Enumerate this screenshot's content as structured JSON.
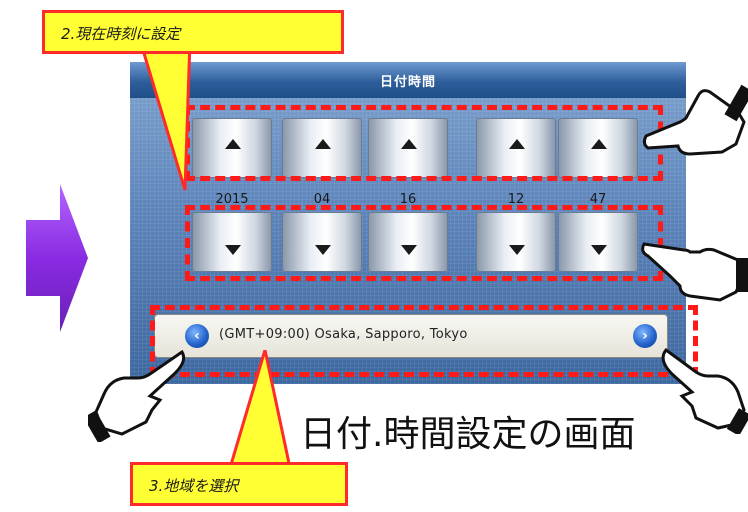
{
  "screen": {
    "title": "日付時間",
    "back_glyph": "⬅"
  },
  "fields": [
    {
      "id": "year",
      "value": "2015"
    },
    {
      "id": "month",
      "value": "04"
    },
    {
      "id": "day",
      "value": "16"
    },
    {
      "id": "hour",
      "value": "12"
    },
    {
      "id": "minute",
      "value": "47"
    }
  ],
  "timezone": {
    "label": "(GMT+09:00)  Osaka, Sapporo, Tokyo",
    "prev_glyph": "‹",
    "next_glyph": "›"
  },
  "callouts": {
    "step2": "2.現在時刻に設定",
    "step3": "3.地域を選択"
  },
  "caption": "日付.時間設定の画面",
  "colors": {
    "highlight": "#ff1a1a",
    "callout_fill": "#ffff33",
    "arrow": "#8a2be2",
    "topbar": "#2e5f9c",
    "tz_button": "#1f5fc8"
  }
}
